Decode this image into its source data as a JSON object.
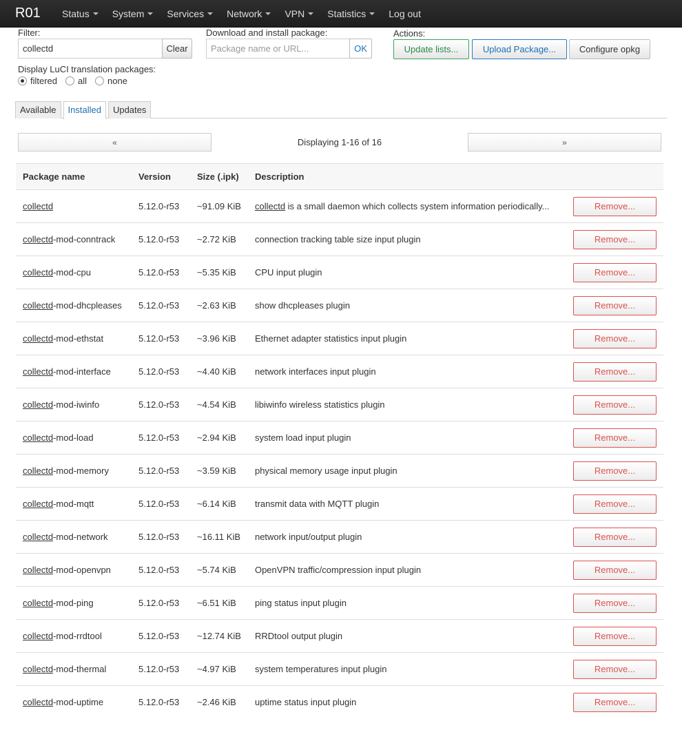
{
  "nav": {
    "brand": "R01",
    "items": [
      {
        "label": "Status",
        "dropdown": true
      },
      {
        "label": "System",
        "dropdown": true
      },
      {
        "label": "Services",
        "dropdown": true
      },
      {
        "label": "Network",
        "dropdown": true
      },
      {
        "label": "VPN",
        "dropdown": true
      },
      {
        "label": "Statistics",
        "dropdown": true
      },
      {
        "label": "Log out",
        "dropdown": false
      }
    ]
  },
  "controls": {
    "filter_label": "Filter:",
    "filter_value": "collectd",
    "clear_label": "Clear",
    "download_label": "Download and install package:",
    "download_placeholder": "Package name or URL...",
    "ok_label": "OK",
    "actions_label": "Actions:",
    "update_lists_label": "Update lists...",
    "upload_package_label": "Upload Package...",
    "configure_opkg_label": "Configure opkg",
    "translation_label": "Display LuCI translation packages:",
    "translation_options": [
      "filtered",
      "all",
      "none"
    ],
    "translation_selected": "filtered"
  },
  "tabs": [
    {
      "label": "Available",
      "active": false
    },
    {
      "label": "Installed",
      "active": true
    },
    {
      "label": "Updates",
      "active": false
    }
  ],
  "pager": {
    "prev": "«",
    "next": "»",
    "status": "Displaying 1-16 of 16"
  },
  "table": {
    "headers": [
      "Package name",
      "Version",
      "Size (.ipk)",
      "Description"
    ],
    "remove_label": "Remove...",
    "rows": [
      {
        "name": "",
        "version": "5.12.0-r53",
        "size": "~91.09 KiB",
        "desc_prefix": "collectd",
        "desc": " is a small daemon which collects system information periodically..."
      },
      {
        "name": "-mod-conntrack",
        "version": "5.12.0-r53",
        "size": "~2.72 KiB",
        "desc_prefix": "",
        "desc": "connection tracking table size input plugin"
      },
      {
        "name": "-mod-cpu",
        "version": "5.12.0-r53",
        "size": "~5.35 KiB",
        "desc_prefix": "",
        "desc": "CPU input plugin"
      },
      {
        "name": "-mod-dhcpleases",
        "version": "5.12.0-r53",
        "size": "~2.63 KiB",
        "desc_prefix": "",
        "desc": "show dhcpleases plugin"
      },
      {
        "name": "-mod-ethstat",
        "version": "5.12.0-r53",
        "size": "~3.96 KiB",
        "desc_prefix": "",
        "desc": "Ethernet adapter statistics input plugin"
      },
      {
        "name": "-mod-interface",
        "version": "5.12.0-r53",
        "size": "~4.40 KiB",
        "desc_prefix": "",
        "desc": "network interfaces input plugin"
      },
      {
        "name": "-mod-iwinfo",
        "version": "5.12.0-r53",
        "size": "~4.54 KiB",
        "desc_prefix": "",
        "desc": "libiwinfo wireless statistics plugin"
      },
      {
        "name": "-mod-load",
        "version": "5.12.0-r53",
        "size": "~2.94 KiB",
        "desc_prefix": "",
        "desc": "system load input plugin"
      },
      {
        "name": "-mod-memory",
        "version": "5.12.0-r53",
        "size": "~3.59 KiB",
        "desc_prefix": "",
        "desc": "physical memory usage input plugin"
      },
      {
        "name": "-mod-mqtt",
        "version": "5.12.0-r53",
        "size": "~6.14 KiB",
        "desc_prefix": "",
        "desc": "transmit data with MQTT plugin"
      },
      {
        "name": "-mod-network",
        "version": "5.12.0-r53",
        "size": "~16.11 KiB",
        "desc_prefix": "",
        "desc": "network input/output plugin"
      },
      {
        "name": "-mod-openvpn",
        "version": "5.12.0-r53",
        "size": "~5.74 KiB",
        "desc_prefix": "",
        "desc": "OpenVPN traffic/compression input plugin"
      },
      {
        "name": "-mod-ping",
        "version": "5.12.0-r53",
        "size": "~6.51 KiB",
        "desc_prefix": "",
        "desc": "ping status input plugin"
      },
      {
        "name": "-mod-rrdtool",
        "version": "5.12.0-r53",
        "size": "~12.74 KiB",
        "desc_prefix": "",
        "desc": "RRDtool output plugin"
      },
      {
        "name": "-mod-thermal",
        "version": "5.12.0-r53",
        "size": "~4.97 KiB",
        "desc_prefix": "",
        "desc": "system temperatures input plugin"
      },
      {
        "name": "-mod-uptime",
        "version": "5.12.0-r53",
        "size": "~2.46 KiB",
        "desc_prefix": "",
        "desc": "uptime status input plugin"
      }
    ]
  }
}
